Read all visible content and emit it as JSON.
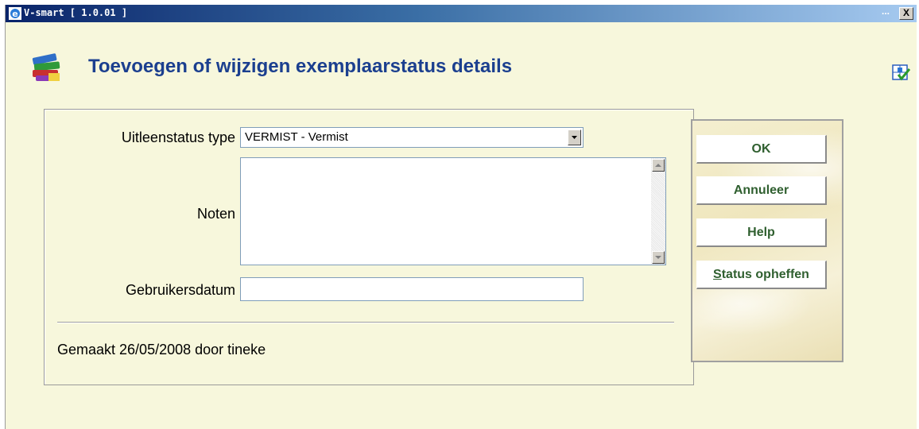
{
  "window": {
    "title": "V-smart [ 1.0.01 ]",
    "title_dots": "...",
    "close_label": "X"
  },
  "page": {
    "title": "Toevoegen of wijzigen exemplaarstatus details"
  },
  "form": {
    "status_type_label": "Uitleenstatus type",
    "status_type_value": "VERMIST - Vermist",
    "notes_label": "Noten",
    "notes_value": "",
    "user_date_label": "Gebruikersdatum",
    "user_date_value": "",
    "created_text": "Gemaakt 26/05/2008 door tineke"
  },
  "buttons": {
    "ok": "OK",
    "cancel": "Annuleer",
    "help": "Help",
    "remove_status_first": "S",
    "remove_status_rest": "tatus opheffen"
  },
  "colors": {
    "background": "#f7f7dc",
    "title_blue": "#1b3f8f",
    "button_text": "#2f5f2f"
  }
}
